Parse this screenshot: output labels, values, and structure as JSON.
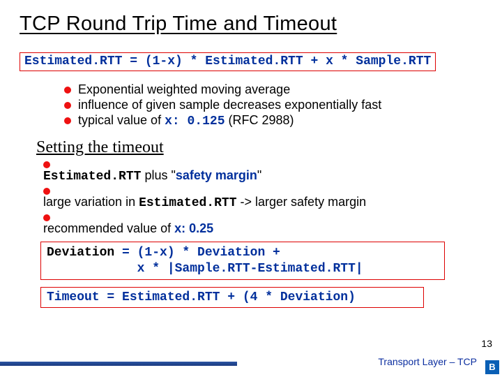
{
  "title": "TCP Round Trip Time and Timeout",
  "formula1": "Estimated.RTT = (1-x) * Estimated.RTT + x * Sample.RTT",
  "bullets1": {
    "b0": "Exponential weighted moving average",
    "b1": "influence of given sample decreases exponentially fast",
    "b2_pre": "typical value of ",
    "b2_hl": "x: 0.125",
    "b2_post": " (RFC 2988)"
  },
  "subhead": "Setting the timeout",
  "bullets2": {
    "r0_a": "Estimated.RTT",
    "r0_b": " plus \"",
    "r0_c": "safety margin",
    "r0_d": "\"",
    "r1_a": "large variation in ",
    "r1_b": "Estimated.RTT",
    "r1_c": " -> larger safety margin",
    "r2_a": "recommended value of ",
    "r2_b": "x: 0.25"
  },
  "devbox": {
    "l1_a": "Deviation",
    "l1_b": " = (1-x) * Deviation +",
    "l2": "            x * |Sample.RTT-Estimated.RTT|"
  },
  "timeout": "Timeout = Estimated.RTT + (4 * Deviation)",
  "pagenum": "13",
  "footer": "Transport Layer – TCP",
  "badge": "B"
}
